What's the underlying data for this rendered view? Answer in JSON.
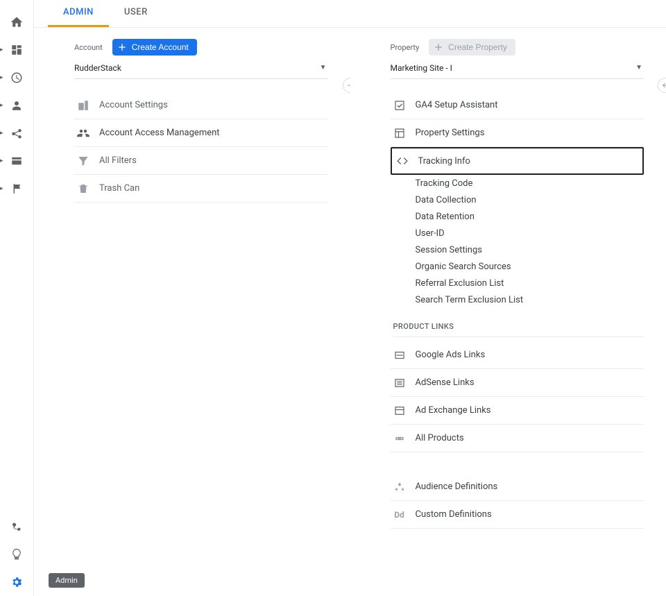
{
  "tabs": {
    "admin": "ADMIN",
    "user": "USER"
  },
  "account": {
    "label": "Account",
    "create_btn": "Create Account",
    "selector_value": "RudderStack",
    "items": [
      {
        "label": "Account Settings",
        "muted": true
      },
      {
        "label": "Account Access Management",
        "muted": false
      },
      {
        "label": "All Filters",
        "muted": true
      },
      {
        "label": "Trash Can",
        "muted": true
      }
    ]
  },
  "property": {
    "label": "Property",
    "create_btn": "Create Property",
    "selector_value": "Marketing Site - I",
    "items": [
      {
        "label": "GA4 Setup Assistant"
      },
      {
        "label": "Property Settings"
      },
      {
        "label": "Tracking Info",
        "highlighted": true,
        "sub": [
          "Tracking Code",
          "Data Collection",
          "Data Retention",
          "User-ID",
          "Session Settings",
          "Organic Search Sources",
          "Referral Exclusion List",
          "Search Term Exclusion List"
        ]
      }
    ],
    "product_links_label": "PRODUCT LINKS",
    "product_links": [
      "Google Ads Links",
      "AdSense Links",
      "Ad Exchange Links",
      "All Products"
    ],
    "more": [
      "Audience Definitions",
      "Custom Definitions"
    ]
  },
  "admin_badge": "Admin"
}
